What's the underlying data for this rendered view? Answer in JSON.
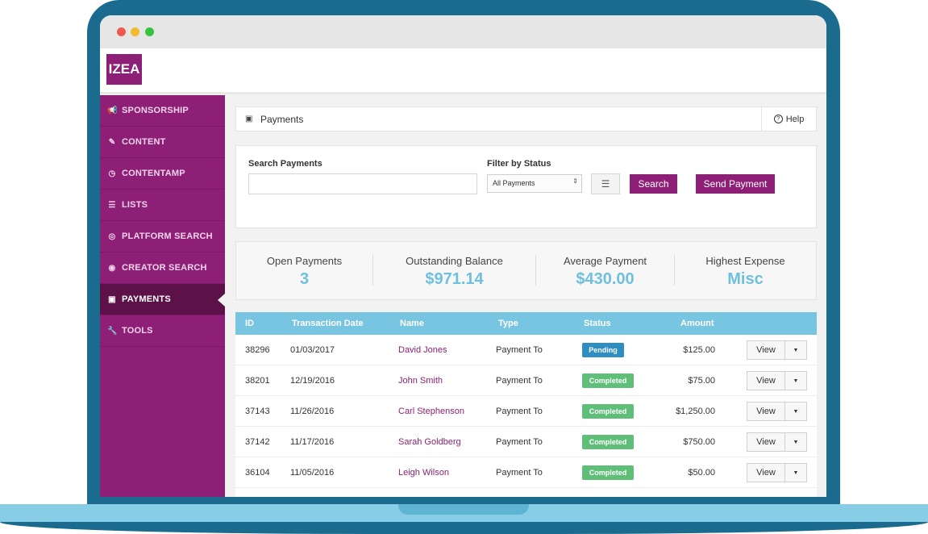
{
  "app": {
    "logo_text": "IZEA"
  },
  "sidebar": {
    "items": [
      {
        "icon": "megaphone-icon",
        "glyph": "📢",
        "label": "SPONSORSHIP",
        "active": false
      },
      {
        "icon": "pencil-icon",
        "glyph": "✎",
        "label": "CONTENT",
        "active": false
      },
      {
        "icon": "clock-icon",
        "glyph": "◷",
        "label": "CONTENTAMP",
        "active": false
      },
      {
        "icon": "list-icon",
        "glyph": "☰",
        "label": "LISTS",
        "active": false
      },
      {
        "icon": "search-circle-icon",
        "glyph": "◎",
        "label": "PLATFORM SEARCH",
        "active": false
      },
      {
        "icon": "user-circle-icon",
        "glyph": "◉",
        "label": "CREATOR SEARCH",
        "active": false
      },
      {
        "icon": "money-icon",
        "glyph": "▣",
        "label": "PAYMENTS",
        "active": true
      },
      {
        "icon": "wrench-icon",
        "glyph": "🔧",
        "label": "TOOLS",
        "active": false
      }
    ]
  },
  "page": {
    "title": "Payments",
    "help_label": "Help"
  },
  "search": {
    "search_label": "Search Payments",
    "search_value": "",
    "filter_label": "Filter by Status",
    "filter_selected": "All Payments",
    "search_button": "Search",
    "send_button": "Send Payment"
  },
  "stats": [
    {
      "label": "Open Payments",
      "value": "3"
    },
    {
      "label": "Outstanding Balance",
      "value": "$971.14"
    },
    {
      "label": "Average Payment",
      "value": "$430.00"
    },
    {
      "label": "Highest Expense",
      "value": "Misc"
    }
  ],
  "table": {
    "headers": [
      "ID",
      "Transaction Date",
      "Name",
      "Type",
      "Status",
      "Amount"
    ],
    "view_label": "View",
    "rows": [
      {
        "id": "38296",
        "date": "01/03/2017",
        "name": "David Jones",
        "type": "Payment To",
        "status": "Pending",
        "amount": "$125.00"
      },
      {
        "id": "38201",
        "date": "12/19/2016",
        "name": "John Smith",
        "type": "Payment To",
        "status": "Completed",
        "amount": "$75.00"
      },
      {
        "id": "37143",
        "date": "11/26/2016",
        "name": "Carl Stephenson",
        "type": "Payment To",
        "status": "Completed",
        "amount": "$1,250.00"
      },
      {
        "id": "37142",
        "date": "11/17/2016",
        "name": "Sarah Goldberg",
        "type": "Payment To",
        "status": "Completed",
        "amount": "$750.00"
      },
      {
        "id": "36104",
        "date": "11/05/2016",
        "name": "Leigh Wilson",
        "type": "Payment To",
        "status": "Completed",
        "amount": "$50.00"
      }
    ]
  },
  "colors": {
    "brand": "#8e1f76",
    "accent": "#77c5e0",
    "pending": "#2f8ec0",
    "completed": "#5fbf79"
  }
}
